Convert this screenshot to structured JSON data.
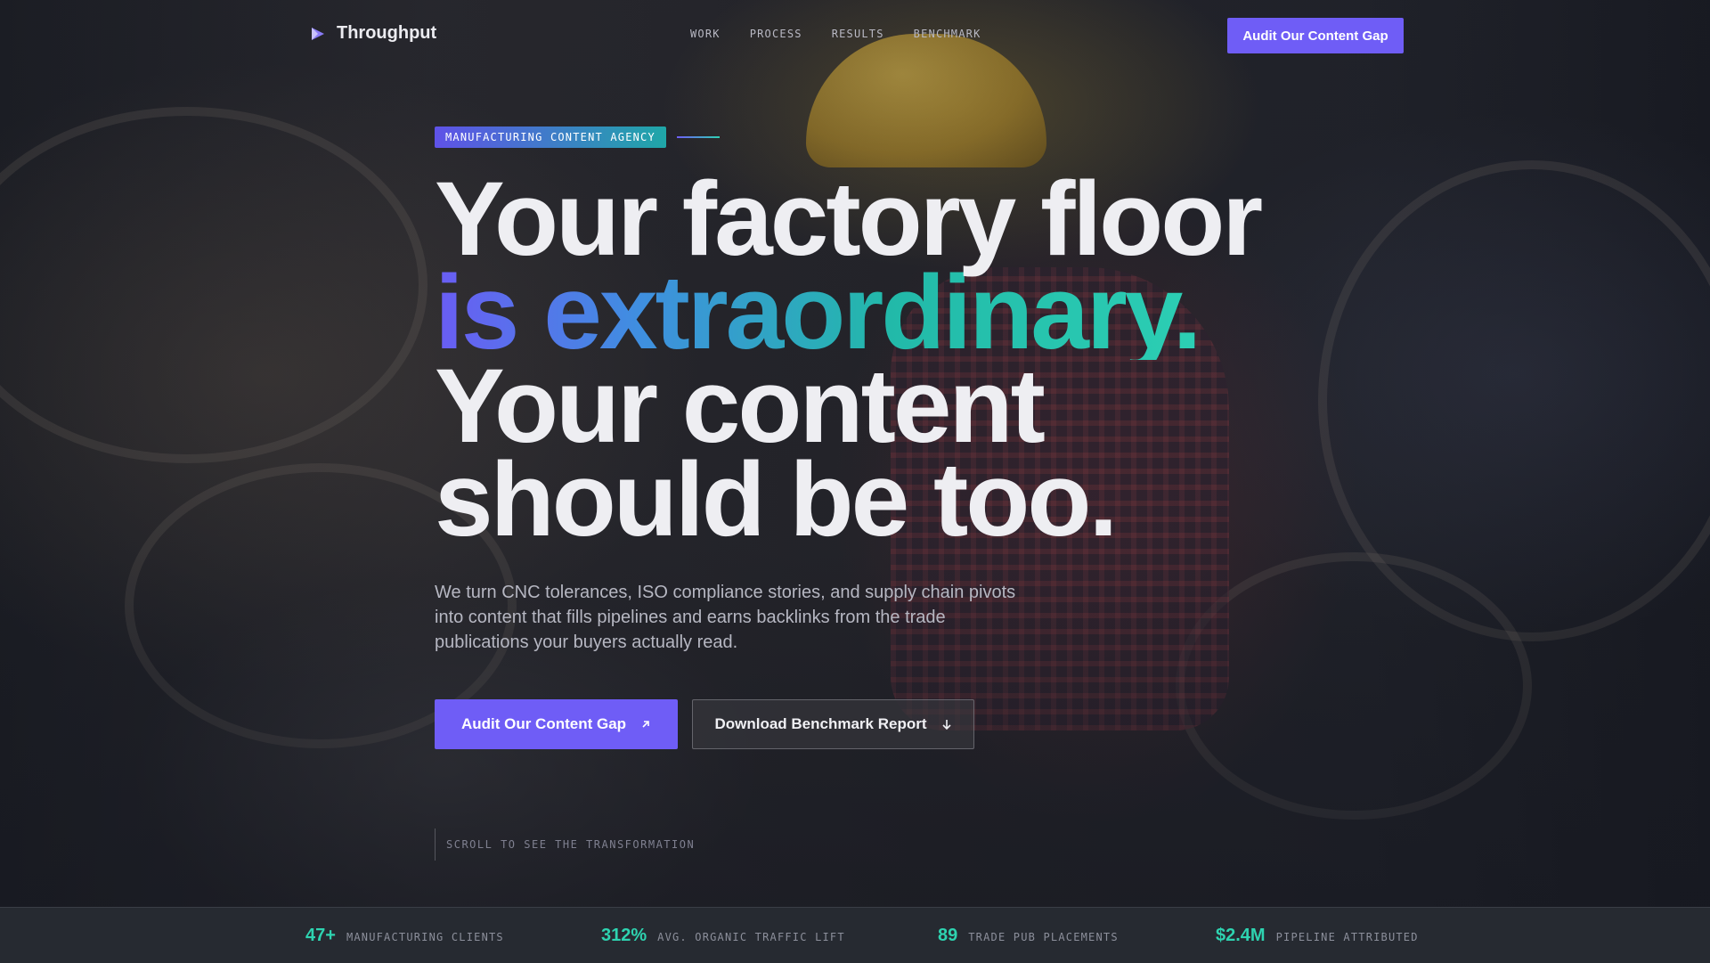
{
  "brand": {
    "name": "Throughput",
    "logo_icon": "play-triangle-logo-icon"
  },
  "nav": {
    "links": [
      "WORK",
      "PROCESS",
      "RESULTS",
      "BENCHMARK"
    ],
    "cta_label": "Audit Our Content Gap"
  },
  "hero": {
    "tag": "MANUFACTURING CONTENT AGENCY",
    "headline": {
      "line1": "Your factory floor",
      "line2": "is extraordinary.",
      "line3": "Your content",
      "line4": "should be too."
    },
    "lede": "We turn CNC tolerances, ISO compliance stories, and supply chain pivots into content that fills pipelines and earns backlinks from the trade publications your buyers actually read.",
    "primary_cta": {
      "label": "Audit Our Content Gap",
      "icon": "arrow-up-right-icon"
    },
    "secondary_cta": {
      "label": "Download Benchmark Report",
      "icon": "arrow-down-icon"
    },
    "scroll_hint": "SCROLL TO SEE THE TRANSFORMATION"
  },
  "stats": [
    {
      "value": "47+",
      "label": "MANUFACTURING CLIENTS"
    },
    {
      "value": "312%",
      "label": "AVG. ORGANIC TRAFFIC LIFT"
    },
    {
      "value": "89",
      "label": "TRADE PUB PLACEMENTS"
    },
    {
      "value": "$2.4M",
      "label": "PIPELINE ATTRIBUTED"
    }
  ],
  "colors": {
    "accent": "#6f5df6",
    "teal": "#2ed3b0",
    "stats_bar": "#262a31"
  }
}
